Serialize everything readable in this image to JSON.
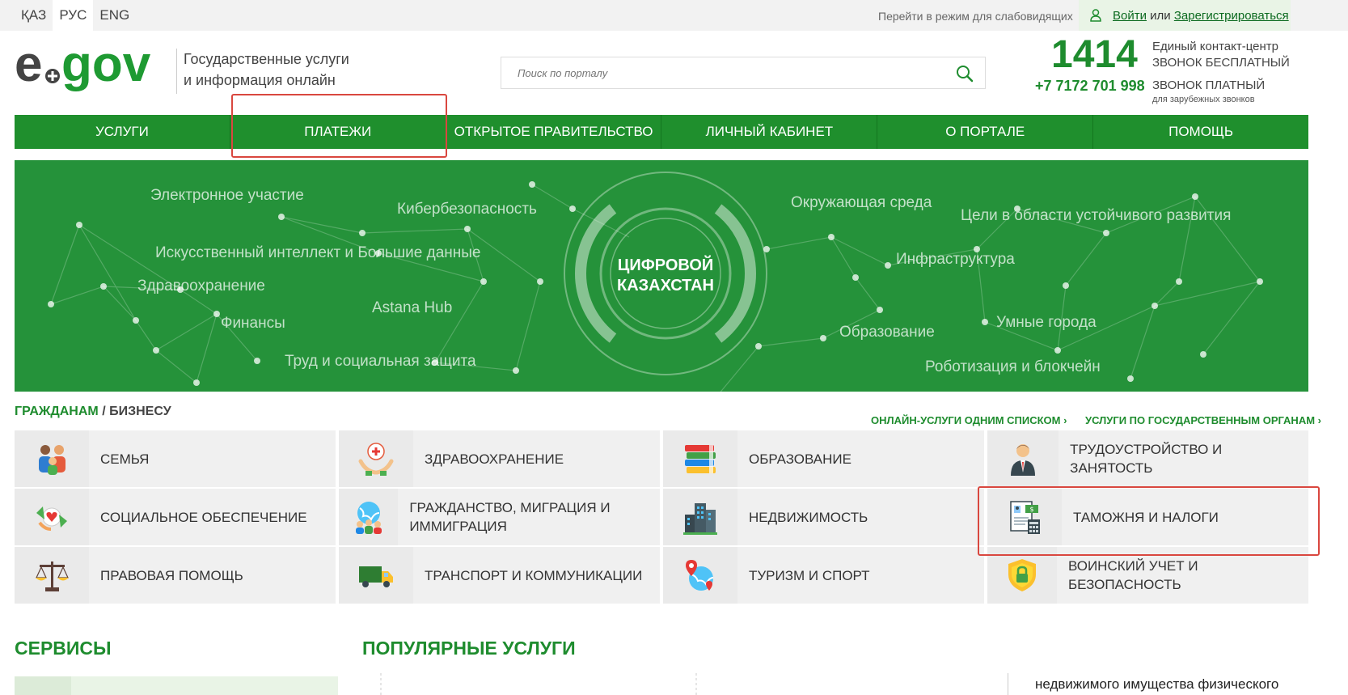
{
  "topbar": {
    "languages": [
      "ҚАЗ",
      "РУС",
      "ENG"
    ],
    "low_vision_link": "Перейти в режим для слабовидящих",
    "login": "Войти",
    "or": " или ",
    "register": "Зарегистрироваться"
  },
  "header": {
    "logo_text": "egov",
    "tagline_line1": "Государственные услуги",
    "tagline_line2": "и информация онлайн",
    "search_placeholder": "Поиск по порталу",
    "hotline_number": "1414",
    "hotline_label1": "Единый контакт-центр",
    "hotline_label2": "ЗВОНОК БЕСПЛАТНЫЙ",
    "phone_number": "+7 7172 701 998",
    "phone_label": "ЗВОНОК ПЛАТНЫЙ",
    "phone_note": "для зарубежных звонков"
  },
  "nav": [
    "Услуги",
    "Платежи",
    "Открытое правительство",
    "Личный кабинет",
    "О портале",
    "Помощь"
  ],
  "banner": {
    "title_line1": "ЦИФРОВОЙ",
    "title_line2": "КАЗАХСТАН",
    "tags": [
      "Электронное участие",
      "Кибербезопасность",
      "Искусственный интеллект и Большие данные",
      "Здравоохранение",
      "Финансы",
      "Astana Hub",
      "Труд и социальная защита",
      "Окружающая среда",
      "Цели в области устойчивого развития",
      "Инфраструктура",
      "Образование",
      "Умные города",
      "Роботизация и блокчейн"
    ]
  },
  "categories": {
    "citizens": "ГРАЖДАНАМ",
    "separator": " / ",
    "business": "БИЗНЕСУ",
    "link_all_online": "ОНЛАЙН-УСЛУГИ ОДНИМ СПИСКОМ ›",
    "link_by_agency": "УСЛУГИ ПО ГОСУДАРСТВЕННЫМ ОРГАНАМ ›",
    "items": [
      {
        "label": "Семья",
        "icon": "family-icon"
      },
      {
        "label": "Здравоохранение",
        "icon": "healthcare-icon"
      },
      {
        "label": "Образование",
        "icon": "books-icon"
      },
      {
        "label": "Трудоустройство и занятость",
        "icon": "worker-icon"
      },
      {
        "label": "Социальное обеспечение",
        "icon": "social-care-icon"
      },
      {
        "label": "Гражданство, миграция и иммиграция",
        "icon": "globe-people-icon"
      },
      {
        "label": "Недвижимость",
        "icon": "buildings-icon"
      },
      {
        "label": "Таможня и налоги",
        "icon": "tax-documents-icon"
      },
      {
        "label": "Правовая помощь",
        "icon": "scales-icon"
      },
      {
        "label": "Транспорт и коммуникации",
        "icon": "truck-icon"
      },
      {
        "label": "Туризм и спорт",
        "icon": "globe-pin-icon"
      },
      {
        "label": "Воинский учет и безопасность",
        "icon": "shield-lock-icon"
      }
    ]
  },
  "sections": {
    "services": "СЕРВИСЫ",
    "popular": "ПОПУЛЯРНЫЕ УСЛУГИ",
    "popular_item_fragment": "недвижимого имущества физического"
  },
  "colors": {
    "brand_green": "#1e8c2e",
    "nav_green": "#1f8f2d",
    "highlight_red": "#d9473f"
  }
}
